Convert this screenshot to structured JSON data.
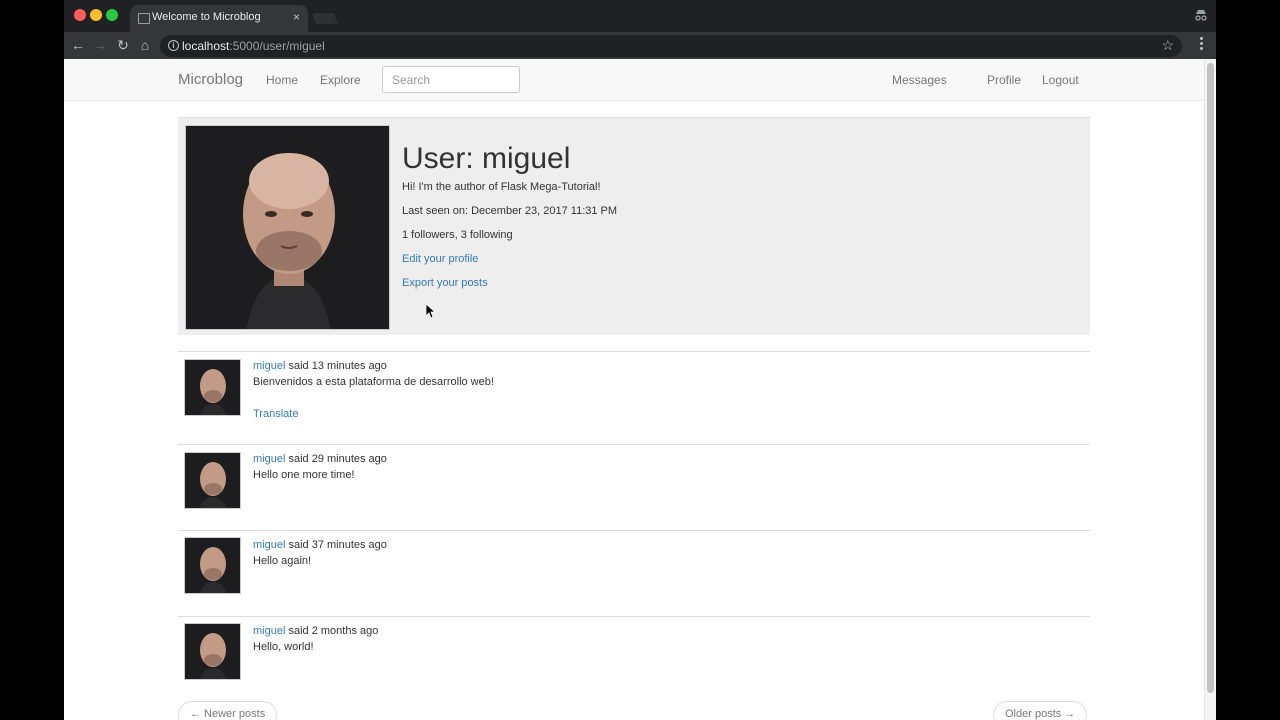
{
  "browser": {
    "tab_title": "Welcome to Microblog",
    "tab_close": "×",
    "url_host": "localhost",
    "url_path": ":5000/user/miguel",
    "back_glyph": "←",
    "forward_glyph": "→",
    "reload_glyph": "↻",
    "home_glyph": "⌂",
    "info_glyph": "i",
    "star_glyph": "☆",
    "traffic_colors": [
      "#ff5f57",
      "#febc2e",
      "#28c840"
    ]
  },
  "navbar": {
    "brand": "Microblog",
    "home": "Home",
    "explore": "Explore",
    "search_placeholder": "Search",
    "messages": "Messages",
    "profile": "Profile",
    "logout": "Logout"
  },
  "profile": {
    "title": "User: miguel",
    "about": "Hi! I'm the author of Flask Mega-Tutorial!",
    "last_seen": "Last seen on: December 23, 2017 11:31 PM",
    "follow_counts": "1 followers, 3 following",
    "edit_link": "Edit your profile",
    "export_link": "Export your posts"
  },
  "posts": [
    {
      "author": "miguel",
      "meta": " said 13 minutes ago",
      "body": "Bienvenidos a esta plataforma de desarrollo web!",
      "translate": "Translate"
    },
    {
      "author": "miguel",
      "meta": " said 29 minutes ago",
      "body": "Hello one more time!"
    },
    {
      "author": "miguel",
      "meta": " said 37 minutes ago",
      "body": "Hello again!"
    },
    {
      "author": "miguel",
      "meta": " said 2 months ago",
      "body": "Hello, world!"
    }
  ],
  "pagination": {
    "newer": "← Newer posts",
    "older": "Older posts →"
  },
  "colors": {
    "link": "#337ab7",
    "navbar_bg": "#f8f8f8",
    "profile_bg": "#eeeeef"
  }
}
